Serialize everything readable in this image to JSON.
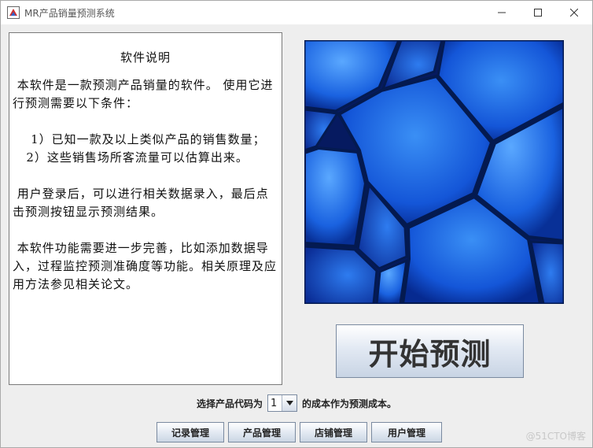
{
  "window": {
    "title": "MR产品销量预测系统",
    "icons": {
      "app": "java-app-icon",
      "minimize": "minimize-icon",
      "maximize": "maximize-icon",
      "close": "close-icon"
    }
  },
  "info": {
    "title": "软件说明",
    "para1": "本软件是一款预测产品销量的软件。 使用它进行预测需要以下条件：",
    "cond1": "1）已知一款及以上类似产品的销售数量；",
    "cond2": "2）这些销售场所客流量可以估算出来。",
    "para2": "用户登录后，可以进行相关数据录入，最后点击预测按钮显示预测结果。",
    "para3": "本软件功能需要进一步完善，比如添加数据导入，过程监控预测准确度等功能。相关原理及应用方法参见相关论文。"
  },
  "image": {
    "description_icon": "blue-cells-image"
  },
  "predict_button": {
    "label": "开始预测"
  },
  "selector": {
    "prefix": "选择产品代码为",
    "value": "1",
    "suffix": "的成本作为预测成本。"
  },
  "buttons": {
    "records": "记录管理",
    "products": "产品管理",
    "stores": "店铺管理",
    "users": "用户管理"
  },
  "watermark": "@51CTO博客",
  "colors": {
    "image_base": "#0a2a8a",
    "button_gradient_end": "#c8d4e4"
  }
}
